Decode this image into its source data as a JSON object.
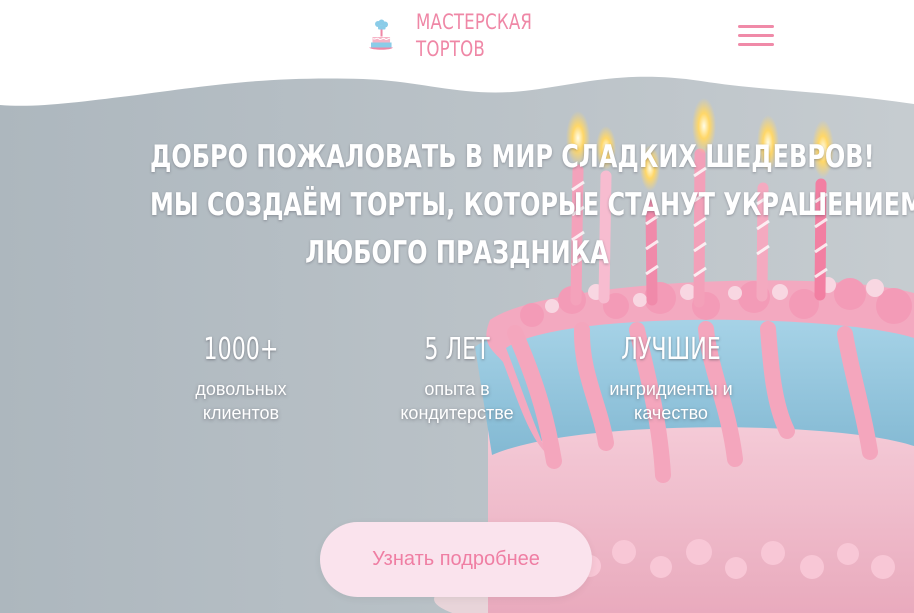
{
  "header": {
    "logo_line1": "МАСТЕРСКАЯ",
    "logo_line2": "ТОРТОВ",
    "logo_icon": "cake-logo-icon",
    "menu_icon": "hamburger-menu-icon"
  },
  "hero": {
    "headline_lines": [
      "Добро пожаловать в мир сладких шедевров!",
      "Мы создаём торты, которые станут украшением",
      "любого праздника"
    ]
  },
  "stats": [
    {
      "value": "1000+",
      "label_line1": "довольных",
      "label_line2": "клиентов"
    },
    {
      "value": "5 лет",
      "label_line1": "опыта в",
      "label_line2": "кондитерстве"
    },
    {
      "value": "Лучшие",
      "label_line1": "ингридиенты и",
      "label_line2": "качество"
    }
  ],
  "cta": {
    "label": "Узнать подробнее"
  },
  "colors": {
    "brand_pink": "#ef87a6",
    "button_background": "#fae3ed",
    "hero_gray": "#b6bfc5",
    "header_white": "#ffffff"
  }
}
